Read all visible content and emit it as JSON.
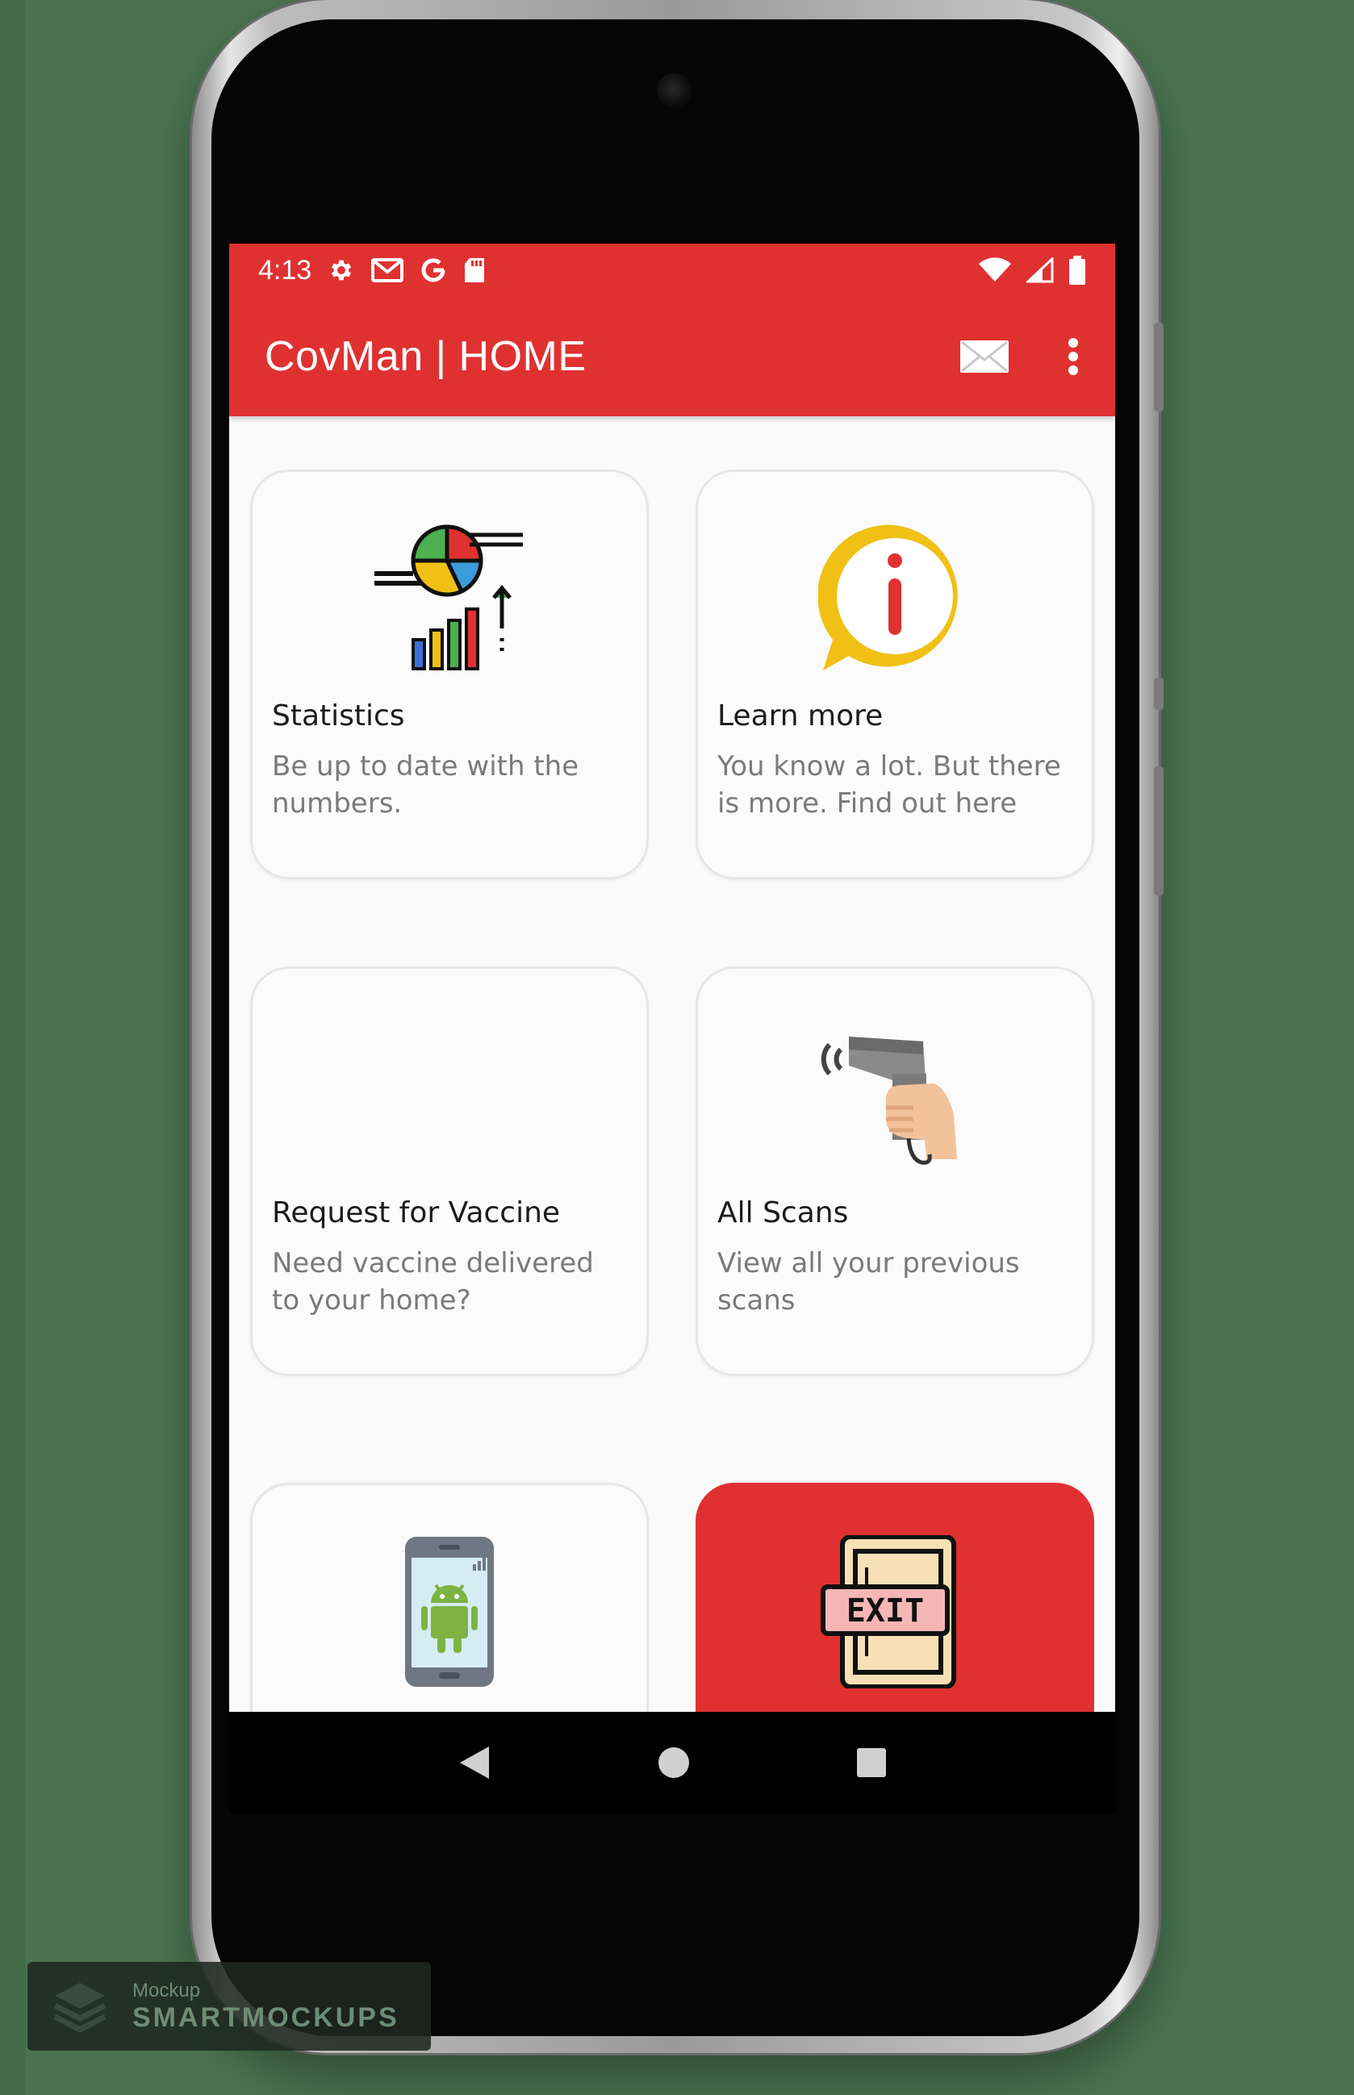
{
  "status_bar": {
    "time": "4:13",
    "left_icons": [
      "gear-icon",
      "gmail-icon",
      "google-icon",
      "sd-card-icon"
    ],
    "right_icons": [
      "wifi-icon",
      "signal-icon",
      "battery-icon"
    ]
  },
  "app_bar": {
    "title": "CovMan | HOME",
    "actions": [
      "mail-icon",
      "more-vert-icon"
    ]
  },
  "cards": [
    {
      "title": "Statistics",
      "description": "Be up to date with the numbers.",
      "icon": "statistics-chart-icon"
    },
    {
      "title": "Learn more",
      "description": "You know a lot. But there is more. Find out here",
      "icon": "info-bubble-icon"
    },
    {
      "title": "Request for Vaccine",
      "description": "Need vaccine delivered to your home?",
      "icon": ""
    },
    {
      "title": "All Scans",
      "description": "View all your previous scans",
      "icon": "barcode-scanner-icon"
    },
    {
      "title": "",
      "description": "",
      "icon": "android-phone-icon"
    },
    {
      "title": "",
      "description": "",
      "icon": "exit-sign-icon"
    }
  ],
  "nav_bar": [
    "back-icon",
    "home-icon",
    "recents-icon"
  ],
  "watermark": {
    "small": "Mockup",
    "big": "SMARTMOCKUPS"
  },
  "colors": {
    "primary": "#e03131",
    "card_border": "#e6e6e6",
    "desc_text": "#7a7a7a"
  }
}
